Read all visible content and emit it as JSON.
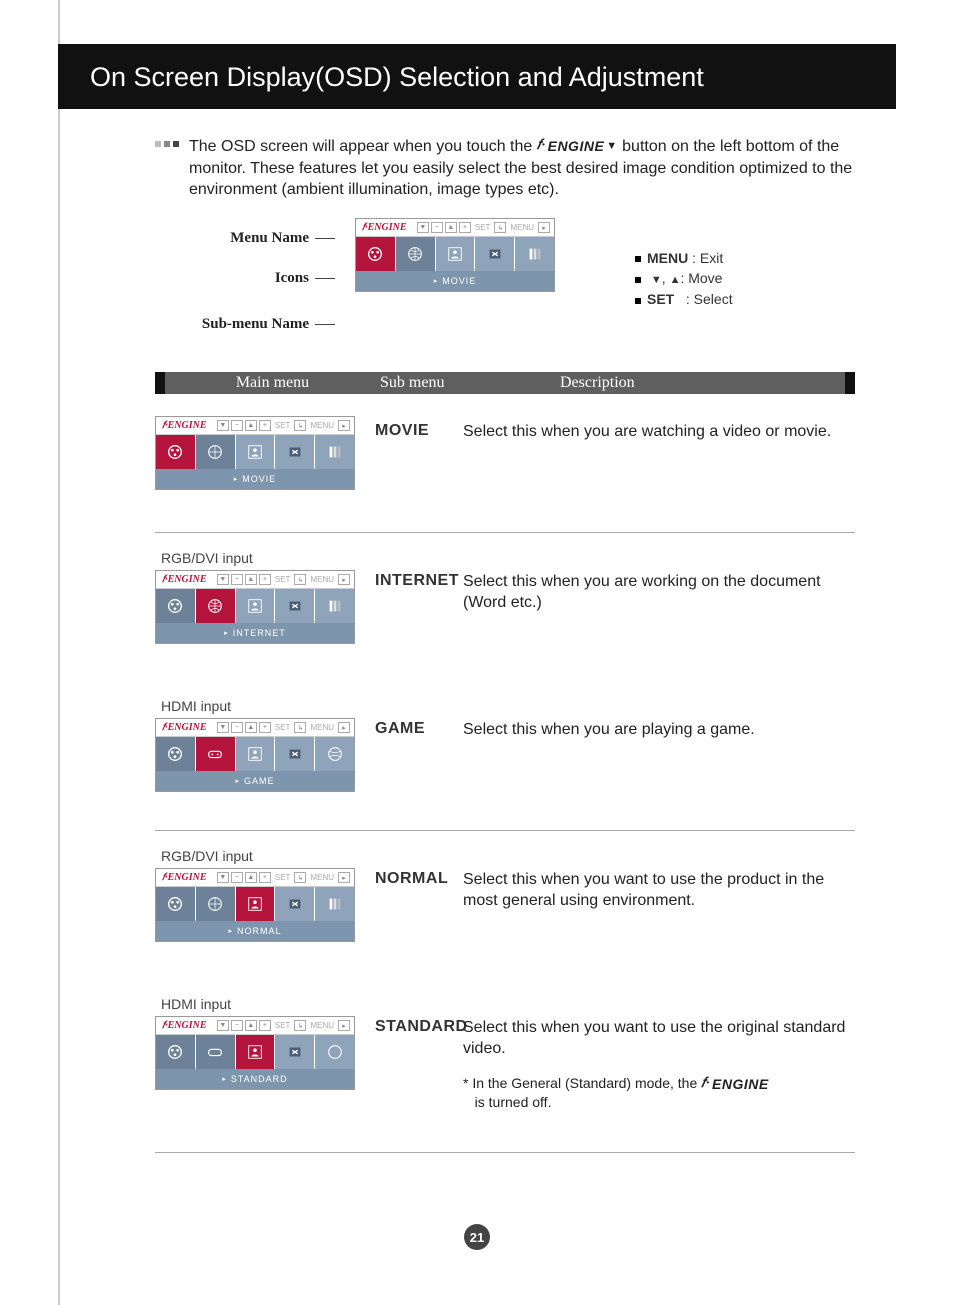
{
  "header": {
    "title": "On Screen Display(OSD) Selection and Adjustment"
  },
  "intro": {
    "line": "The OSD screen will appear when you touch the ",
    "fengine": "ENGINE",
    "line2": " button on the left bottom of the monitor. These features let you easily select the best desired image condition optimized to the environment (ambient illumination, image types etc)."
  },
  "diagram_labels": {
    "menu": "Menu Name",
    "icons": "Icons",
    "sub": "Sub-menu Name"
  },
  "legend": {
    "menu_key": "MENU",
    "menu_txt": ": Exit",
    "move_txt": ": Move",
    "set_key": "SET",
    "set_txt": ": Select"
  },
  "table_header": {
    "c1": "Main menu",
    "c2": "Sub menu",
    "c3": "Description"
  },
  "osd_labels": {
    "set": "SET",
    "menu": "MENU"
  },
  "modes": {
    "movie": {
      "sub": "MOVIE",
      "osd_sub": "MOVIE",
      "desc": "Select this when you are watching a video or movie."
    },
    "internet": {
      "sub": "INTERNET",
      "osd_sub": "INTERNET",
      "desc": "Select this when you are working on the document (Word etc.)",
      "input": "RGB/DVI input"
    },
    "game": {
      "sub": "GAME",
      "osd_sub": "GAME",
      "desc": "Select this when you are playing a game.",
      "input": "HDMI input"
    },
    "normal": {
      "sub": "NORMAL",
      "osd_sub": "NORMAL",
      "desc": "Select this when you want to use the product in the most general using environment.",
      "input": "RGB/DVI input"
    },
    "standard": {
      "sub": "STANDARD",
      "osd_sub": "STANDARD",
      "desc": "Select this when you want to use the original standard video.",
      "input": "HDMI input",
      "note_pre": "* In the General (Standard) mode, the ",
      "note_post": " is turned off."
    }
  },
  "page": "21"
}
